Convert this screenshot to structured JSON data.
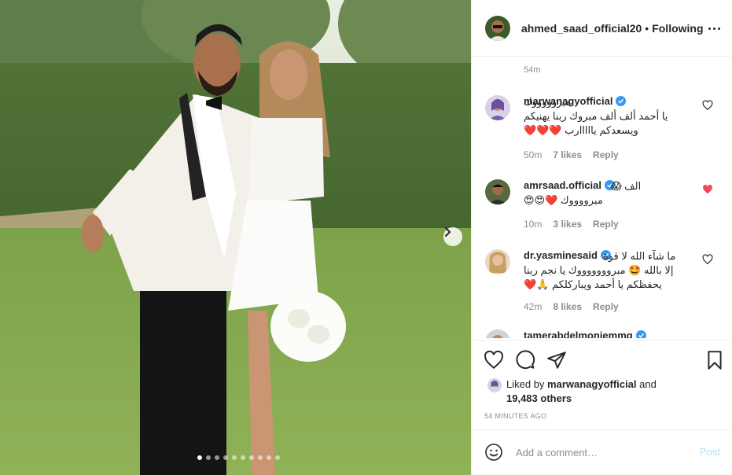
{
  "post": {
    "username": "ahmed_saad_official20",
    "separator": "•",
    "follow_status": "Following",
    "caption_time": "54m"
  },
  "carousel": {
    "slide_count": 10,
    "active_index": 0
  },
  "comments": [
    {
      "username": "marwanagyofficial",
      "verified": true,
      "lines": [
        "مبروووووك",
        "يا أحمد ألف ألف مبروك ربنا يهنيكم",
        "ويسعدكم يااااارب ❤️❤️❤️"
      ],
      "time": "50m",
      "likes": "7 likes",
      "reply": "Reply",
      "liked": false
    },
    {
      "username": "amrsaad.official",
      "verified": true,
      "lines": [
        "الف 😱",
        "مبرووووك ❤️😍😍"
      ],
      "time": "10m",
      "likes": "3 likes",
      "reply": "Reply",
      "liked": true
    },
    {
      "username": "dr.yasminesaid",
      "verified": true,
      "lines": [
        "ما شآء الله لا قوة",
        "إلا بالله 🤩 مبروووووووك يا نجم ربنا",
        "يحفظكم يا أحمد ويباركلكم 🙏❤️"
      ],
      "time": "42m",
      "likes": "8 likes",
      "reply": "Reply",
      "liked": false
    },
    {
      "username": "tamerabdelmoniemmg",
      "verified": true
    }
  ],
  "likes": {
    "prefix": "Liked by",
    "user": "marwanagyofficial",
    "joiner": "and",
    "count": "19,483 others"
  },
  "timestamp": "54 MINUTES AGO",
  "comment_box": {
    "placeholder": "Add a comment…",
    "post_label": "Post"
  },
  "colors": {
    "link_blue": "#3897f0",
    "heart_red": "#ed4956",
    "post_disabled": "#b2dffc"
  }
}
